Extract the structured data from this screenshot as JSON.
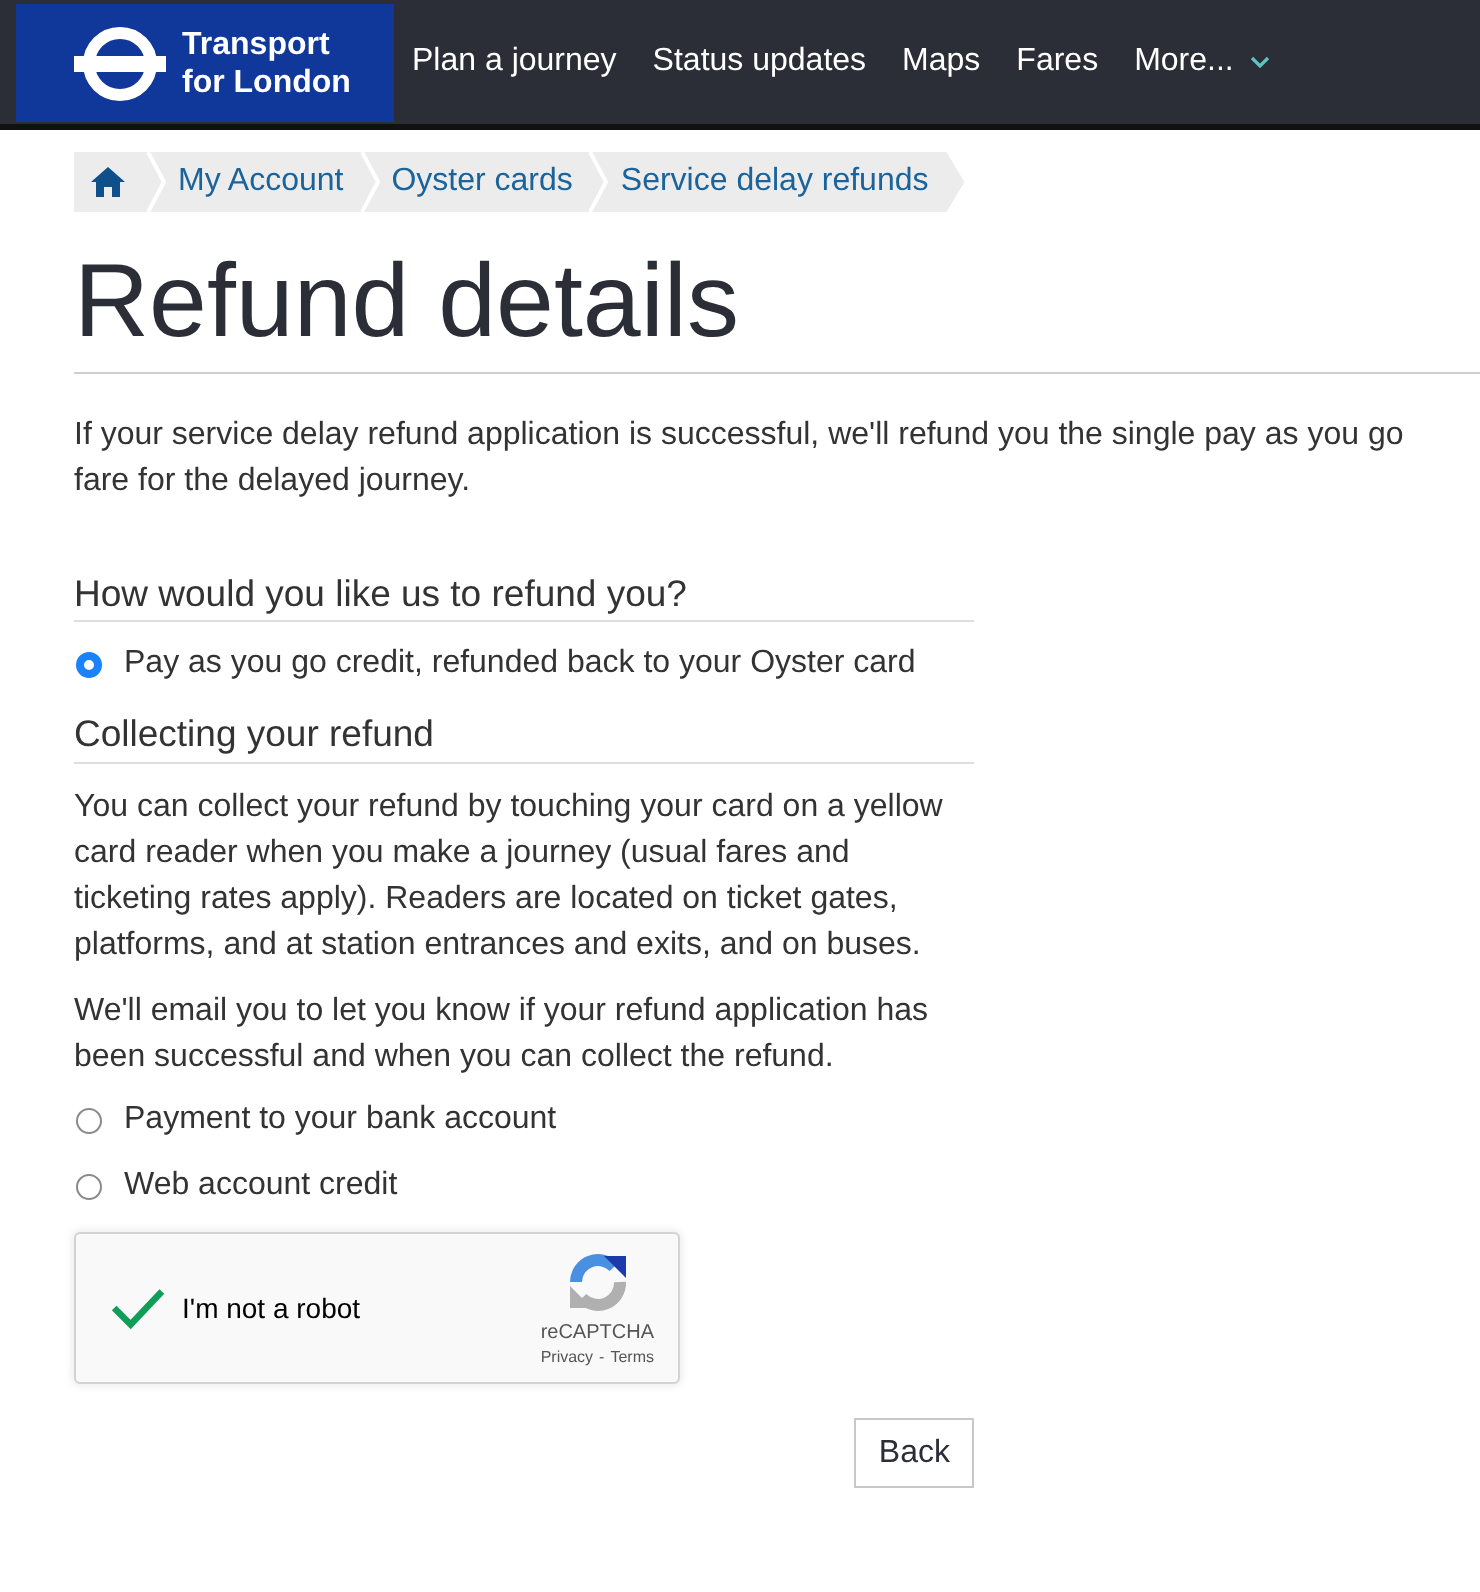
{
  "header": {
    "brand": "Transport for London",
    "nav": [
      {
        "label": "Plan a journey",
        "dropdown": false
      },
      {
        "label": "Status updates",
        "dropdown": false
      },
      {
        "label": "Maps",
        "dropdown": false
      },
      {
        "label": "Fares",
        "dropdown": false
      },
      {
        "label": "More...",
        "dropdown": true
      }
    ]
  },
  "breadcrumb": [
    {
      "kind": "home"
    },
    {
      "kind": "link",
      "label": "My Account"
    },
    {
      "kind": "link",
      "label": "Oyster cards"
    },
    {
      "kind": "link",
      "label": "Service delay refunds"
    }
  ],
  "page": {
    "title": "Refund details",
    "intro": "If your service delay refund application is successful, we'll refund you the single pay as you go fare for the delayed journey."
  },
  "refund_method": {
    "question": "How would you like us to refund you?",
    "options": [
      {
        "label": "Pay as you go credit, refunded back to your Oyster card",
        "selected": true,
        "details": {
          "heading": "Collecting your refund",
          "paragraphs": [
            "You can collect your refund by touching your card on a yellow card reader when you make a journey (usual fares and ticketing rates apply). Readers are located on ticket gates, platforms, and at station entrances and exits, and on buses.",
            "We'll email you to let you know if your refund application has been successful and when you can collect the refund."
          ]
        }
      },
      {
        "label": "Payment to your bank account",
        "selected": false
      },
      {
        "label": "Web account credit",
        "selected": false
      }
    ]
  },
  "captcha": {
    "label": "I'm not a robot",
    "checked": true,
    "brand": "reCAPTCHA",
    "links": [
      "Privacy",
      "Terms"
    ],
    "separator": "-"
  },
  "buttons": [
    {
      "label": "Back"
    }
  ]
}
